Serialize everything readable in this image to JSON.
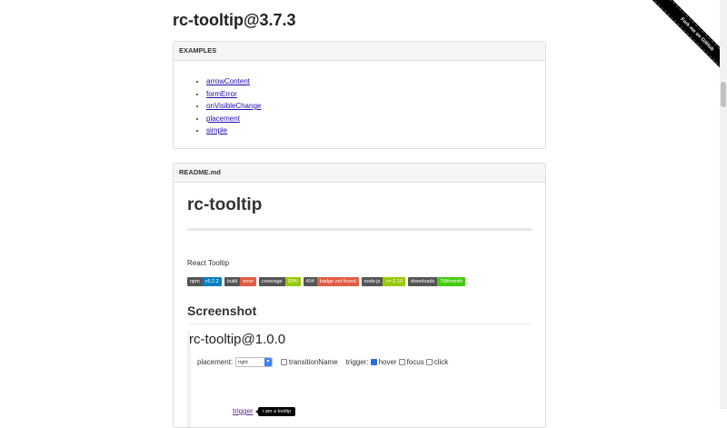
{
  "page": {
    "title": "rc-tooltip@3.7.3"
  },
  "ribbon": {
    "label": "Fork me on GitHub"
  },
  "examples": {
    "heading": "EXAMPLES",
    "links": [
      "arrowContent",
      "formError",
      "onVisibleChange",
      "placement",
      "simple"
    ]
  },
  "readme": {
    "heading": "README.md",
    "title": "rc-tooltip",
    "description": "React Tooltip",
    "badges": [
      {
        "key": "npm",
        "value": "v5.2.2",
        "color": "#007ec6"
      },
      {
        "key": "build",
        "value": "error",
        "color": "#e05d44"
      },
      {
        "key": "coverage",
        "value": "93%",
        "color": "#97ca00"
      },
      {
        "key": "404",
        "value": "badge not found",
        "color": "#e05d44"
      },
      {
        "key": "node.js",
        "value": ">= 0.10",
        "color": "#97ca00"
      },
      {
        "key": "downloads",
        "value": "7M/month",
        "color": "#4c1"
      }
    ],
    "screenshot_heading": "Screenshot"
  },
  "screenshot": {
    "title": "rc-tooltip@1.0.0",
    "placement_label": "placement:",
    "placement_value": "right",
    "transition_label": "transitionName",
    "trigger_label": "trigger:",
    "options": [
      {
        "label": "hover",
        "checked": true
      },
      {
        "label": "focus",
        "checked": false
      },
      {
        "label": "click",
        "checked": false
      }
    ],
    "trigger_link": "trigger",
    "tooltip_text": "i am a tooltip"
  }
}
